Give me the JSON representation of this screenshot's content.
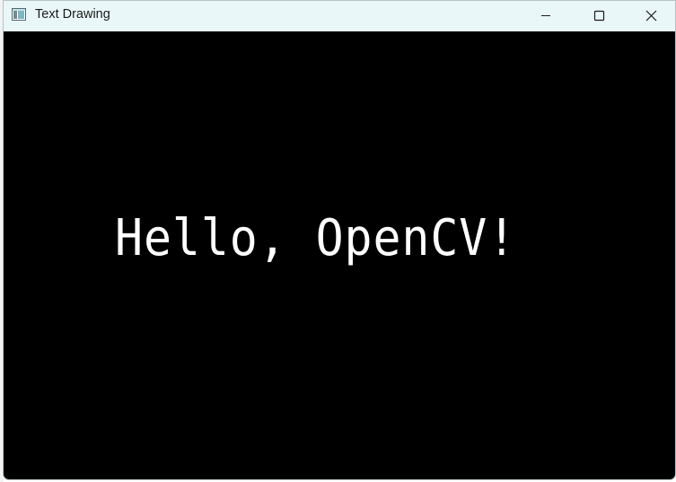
{
  "window": {
    "title": "Text Drawing",
    "icons": {
      "app": "app-window-icon",
      "minimize": "minimize-icon",
      "maximize": "maximize-icon",
      "close": "close-icon"
    }
  },
  "canvas": {
    "text": "Hello, OpenCV!",
    "background": "#000000",
    "text_color": "#ffffff"
  },
  "colors": {
    "titlebar": "#e9f7f8",
    "title_text": "#1b1b1b"
  }
}
